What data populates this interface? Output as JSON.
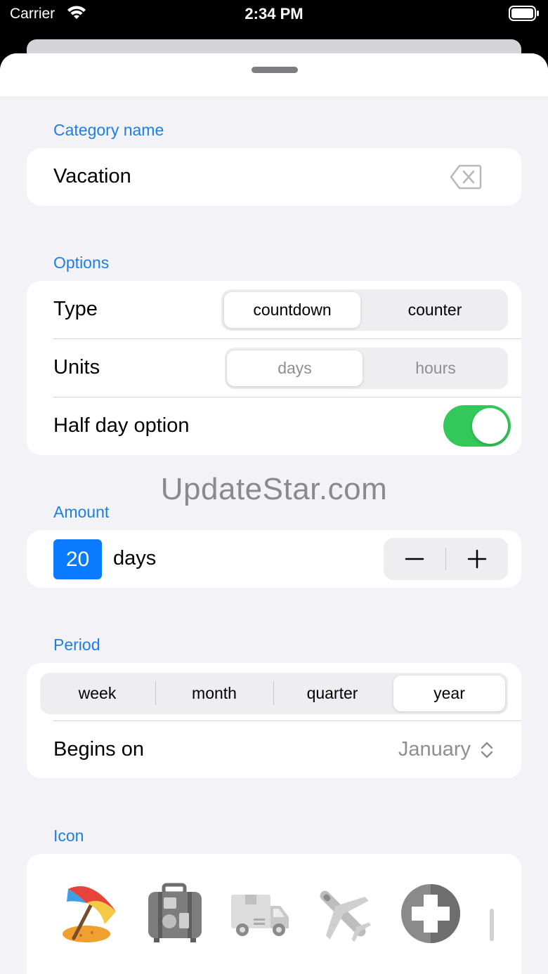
{
  "status_bar": {
    "carrier": "Carrier",
    "time": "2:34 PM"
  },
  "category": {
    "title": "Category name",
    "value": "Vacation"
  },
  "options": {
    "title": "Options",
    "type_label": "Type",
    "type_options": [
      "countdown",
      "counter"
    ],
    "type_selected": "countdown",
    "units_label": "Units",
    "units_options": [
      "days",
      "hours"
    ],
    "units_selected": "days",
    "half_day_label": "Half day option",
    "half_day_on": true
  },
  "watermark": "UpdateStar.com",
  "amount": {
    "title": "Amount",
    "value": "20",
    "unit": "days",
    "minus": "−",
    "plus": "+"
  },
  "period": {
    "title": "Period",
    "options": [
      "week",
      "month",
      "quarter",
      "year"
    ],
    "selected": "year",
    "begins_label": "Begins on",
    "begins_value": "January"
  },
  "icon_section": {
    "title": "Icon",
    "icons": [
      "beach-umbrella-icon",
      "suitcase-icon",
      "delivery-truck-icon",
      "airplane-icon",
      "medical-cross-icon",
      "thermometer-icon"
    ]
  },
  "colors": {
    "accent": "#1d7fe6",
    "toggle_on": "#34c759",
    "field_blue": "#0a7aff",
    "background": "#f2f2f7"
  }
}
